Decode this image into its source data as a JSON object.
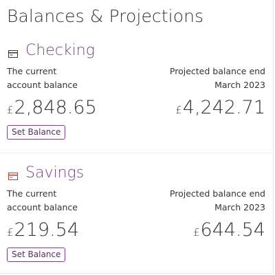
{
  "page": {
    "title": "Balances & Projections"
  },
  "accounts": [
    {
      "name": "Checking",
      "icon": "card-icon",
      "icon_color": "#333333",
      "current_label_line1": "The current",
      "current_label_line2": "account balance",
      "projection_label_line1": "Projected balance end",
      "projection_label_line2": "March 2023",
      "currency_symbol": "£",
      "current_balance": "2,848.65",
      "projected_balance": "4,242.71",
      "button_label": "Set Balance"
    },
    {
      "name": "Savings",
      "icon": "card-icon",
      "icon_color": "#c0392b",
      "current_label_line1": "The current",
      "current_label_line2": "account balance",
      "projection_label_line1": "Projected balance end",
      "projection_label_line2": "March 2023",
      "currency_symbol": "£",
      "current_balance": "219.54",
      "projected_balance": "644.54",
      "button_label": "Set Balance"
    }
  ],
  "colors": {
    "accent": "#7a3f8a",
    "text": "#333333",
    "border": "#e6e6e6"
  }
}
